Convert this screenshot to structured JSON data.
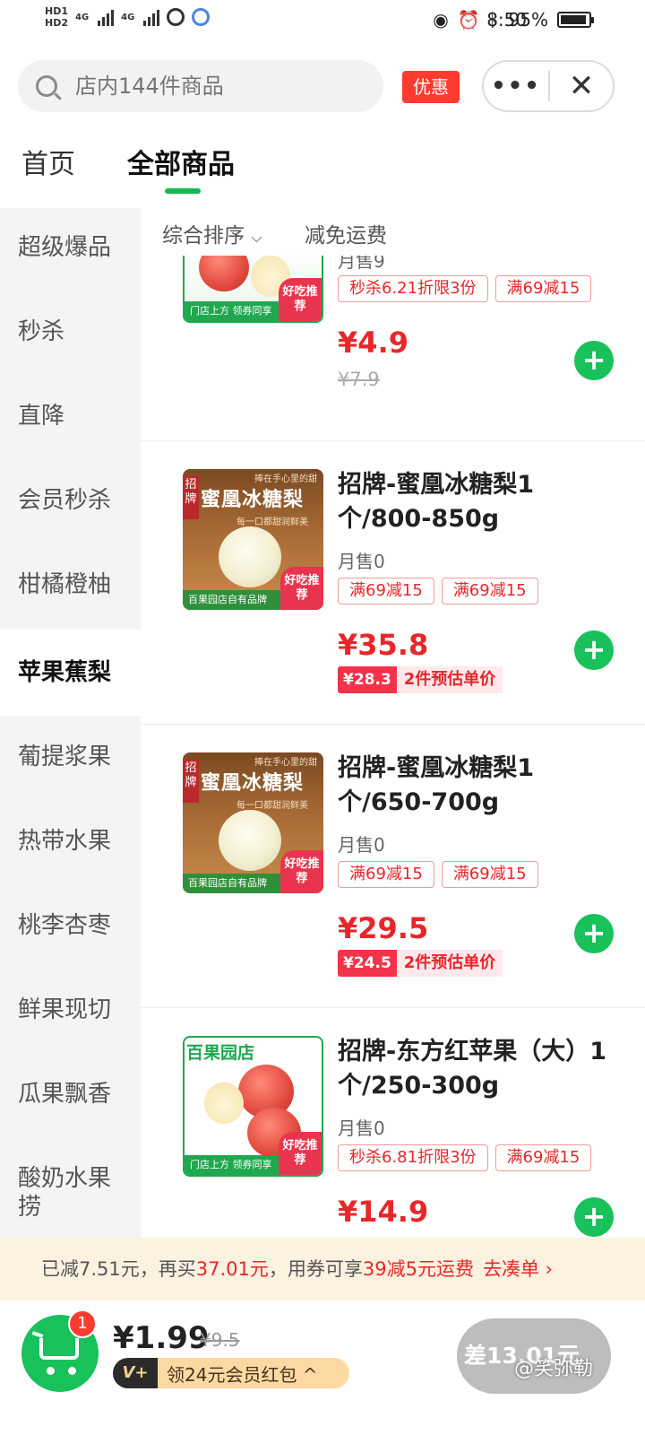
{
  "status": {
    "time": "8:50",
    "battery": "95%",
    "network_a": "4G",
    "network_b": "4G",
    "hd1": "HD1",
    "hd2": "HD2"
  },
  "search": {
    "placeholder": "店内144件商品",
    "promo_label": "优惠"
  },
  "tabs": [
    {
      "label": "首页"
    },
    {
      "label": "全部商品"
    }
  ],
  "categories": [
    {
      "label": "超级爆品"
    },
    {
      "label": "秒杀"
    },
    {
      "label": "直降"
    },
    {
      "label": "会员秒杀"
    },
    {
      "label": "柑橘橙柚"
    },
    {
      "label": "苹果蕉梨"
    },
    {
      "label": "葡提浆果"
    },
    {
      "label": "热带水果"
    },
    {
      "label": "桃李杏枣"
    },
    {
      "label": "鲜果现切"
    },
    {
      "label": "瓜果飘香"
    },
    {
      "label": "酸奶水果捞"
    }
  ],
  "sort": {
    "option": "综合排序",
    "free_shipping": "减免运费"
  },
  "image_texts": {
    "recommend": "好吃推荐",
    "store_coupon": "门店上方  领券同享",
    "brand_own": "百果园店自有品牌",
    "pear_title": "蜜凰冰糖梨",
    "pear_tag": "招牌",
    "pear_slogan": "捧在手心里的甜",
    "pear_sub": "每一口都甜润鲜美",
    "store_name": "百果园店"
  },
  "products": [
    {
      "title": "",
      "sales": "月售9",
      "tags": [
        "秒杀6.21折限3份",
        "满69减15"
      ],
      "price": "¥4.9",
      "original_price": "¥7.9"
    },
    {
      "title": "招牌-蜜凰冰糖梨1个/800-850g",
      "sales": "月售0",
      "tags": [
        "满69减15",
        "满69减15"
      ],
      "price": "¥35.8",
      "est_price": "¥28.3",
      "est_label": "2件预估单价"
    },
    {
      "title": "招牌-蜜凰冰糖梨1个/650-700g",
      "sales": "月售0",
      "tags": [
        "满69减15",
        "满69减15"
      ],
      "price": "¥29.5",
      "est_price": "¥24.5",
      "est_label": "2件预估单价"
    },
    {
      "title": "招牌-东方红苹果（大）1个/250-300g",
      "sales": "月售0",
      "tags": [
        "秒杀6.81折限3份",
        "满69减15"
      ],
      "price": "¥14.9"
    }
  ],
  "promo_bar": {
    "text1": "已减7.51元，再买",
    "amount": "37.01元",
    "text2": "，用券可享",
    "deal": "39减5元运费",
    "go": "去凑单 ›"
  },
  "cart": {
    "count": "1",
    "total": "¥1.99",
    "original": "¥9.5",
    "vip_badge": "V+",
    "vip_text": "领24元会员红包 ^",
    "checkout": "差13.01元",
    "watermark": "@笑弥勒"
  },
  "colors": {
    "brand_green": "#18c15a",
    "price_red": "#e8262a",
    "promo_bg": "#fdf1df"
  }
}
